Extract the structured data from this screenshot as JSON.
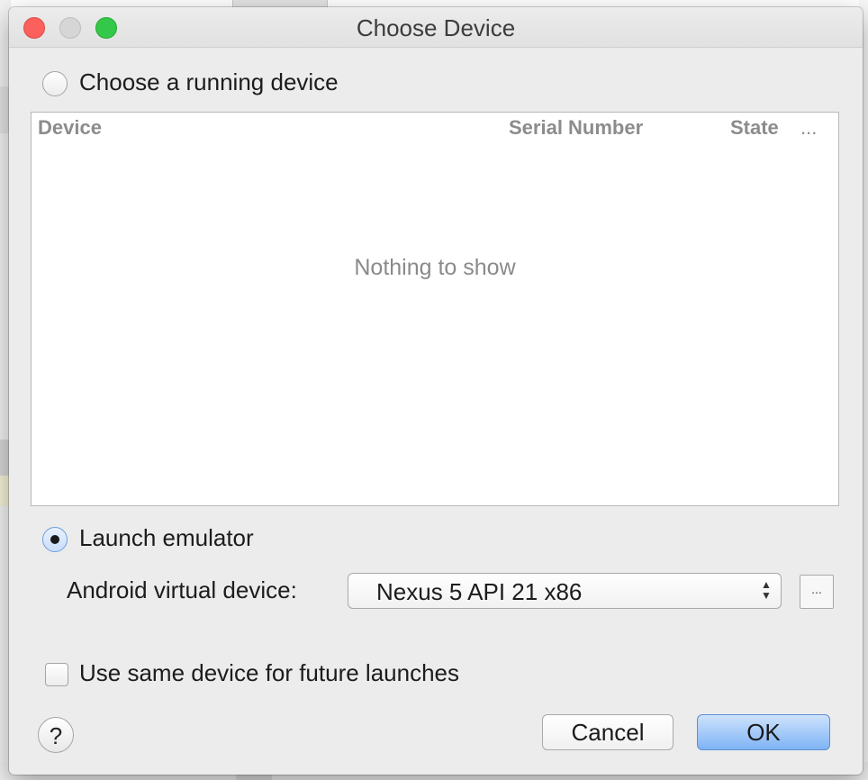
{
  "dialog": {
    "title": "Choose Device"
  },
  "running_device": {
    "label": "Choose a running device",
    "selected": false
  },
  "device_table": {
    "columns": [
      "Device",
      "Serial Number",
      "State",
      "..."
    ],
    "empty_text": "Nothing to show"
  },
  "launch_emulator": {
    "label": "Launch emulator",
    "selected": true
  },
  "avd": {
    "label": "Android virtual device:",
    "value": "Nexus 5 API 21 x86",
    "browse_label": "..."
  },
  "same_device": {
    "label": "Use same device for future launches",
    "checked": false
  },
  "buttons": {
    "help": "?",
    "cancel": "Cancel",
    "ok": "OK"
  },
  "colors": {
    "close": "#fc605c",
    "minimize": "#d6d6d6",
    "zoom": "#34c84a",
    "default_button": "#7fb4f5"
  }
}
